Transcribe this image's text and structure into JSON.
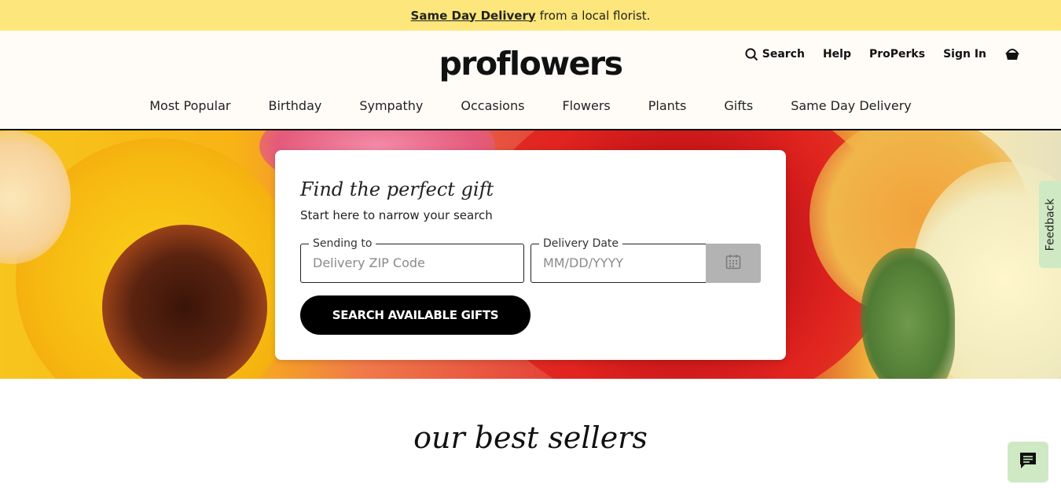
{
  "promo": {
    "link": "Same Day Delivery",
    "rest": "from a local florist."
  },
  "brand": {
    "name": "proflowers"
  },
  "utility_nav": {
    "search": "Search",
    "help": "Help",
    "properks": "ProPerks",
    "sign_in": "Sign In",
    "cart_icon": "basket-icon"
  },
  "main_nav": [
    "Most Popular",
    "Birthday",
    "Sympathy",
    "Occasions",
    "Flowers",
    "Plants",
    "Gifts",
    "Same Day Delivery"
  ],
  "finder": {
    "title": "Find the perfect gift",
    "subtitle": "Start here to narrow your search",
    "zip_label": "Sending to",
    "zip_placeholder": "Delivery ZIP Code",
    "date_label": "Delivery Date",
    "date_placeholder": "MM/DD/YYYY",
    "calendar_icon": "calendar-icon",
    "cta": "SEARCH AVAILABLE GIFTS"
  },
  "feedback_tab": "Feedback",
  "section_title": "our best sellers",
  "colors": {
    "promo_bg": "#fde77c",
    "header_bg": "#fffcf8",
    "cta_bg": "#000000",
    "accent_green": "#cfe9c4"
  }
}
